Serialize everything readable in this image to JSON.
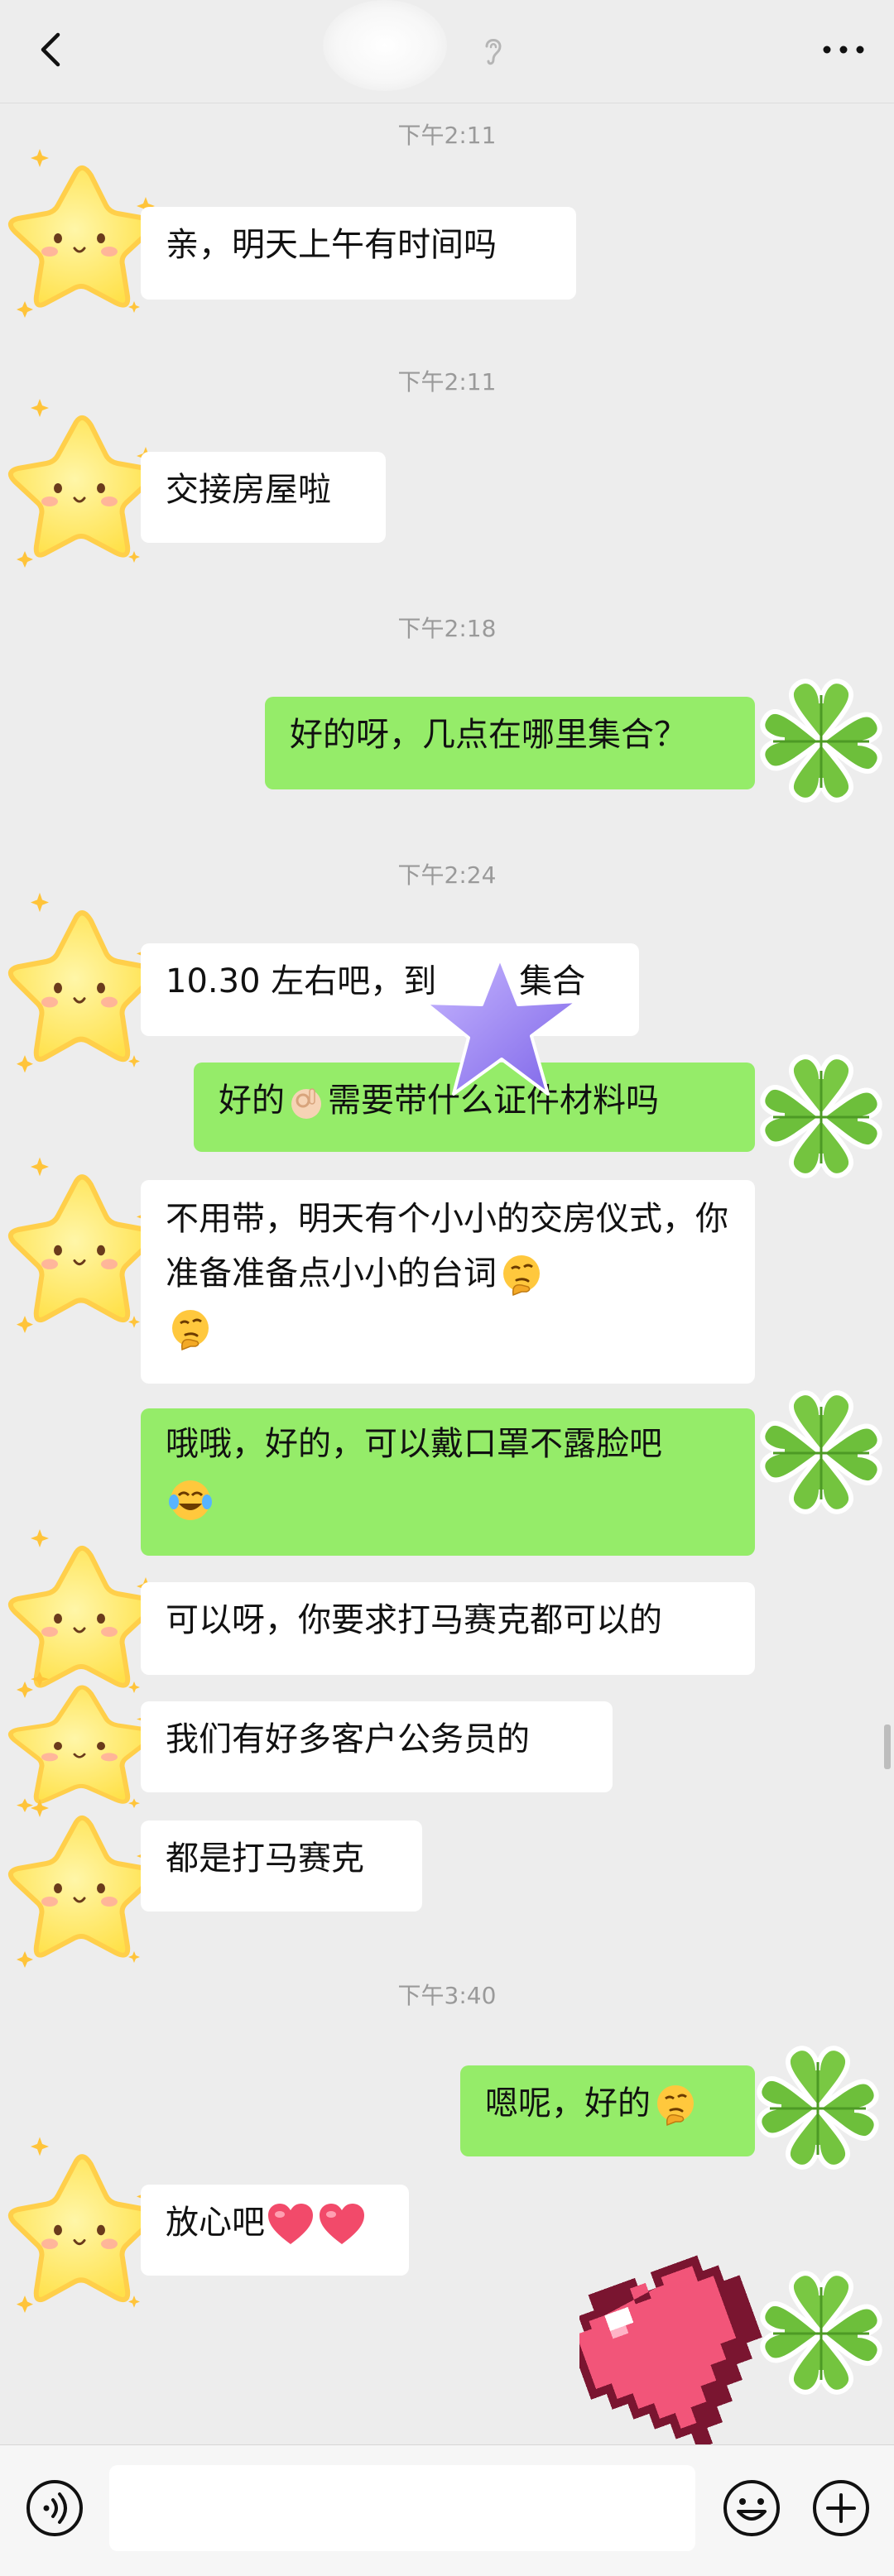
{
  "header": {
    "back_icon": "chevron-left-icon",
    "more_icon": "more-dots-icon",
    "title_hint_icon": "ear-icon"
  },
  "colors": {
    "background": "#ededed",
    "incoming_bubble": "#ffffff",
    "outgoing_bubble": "#95ec69",
    "timestamp": "#9a9a9a"
  },
  "messages": [
    {
      "type": "time",
      "text": "下午2:11"
    },
    {
      "type": "in",
      "text": "亲，明天上午有时间吗"
    },
    {
      "type": "time",
      "text": "下午2:11"
    },
    {
      "type": "in",
      "text": "交接房屋啦"
    },
    {
      "type": "time",
      "text": "下午2:18"
    },
    {
      "type": "out",
      "text": "好的呀，几点在哪里集合？"
    },
    {
      "type": "time",
      "text": "下午2:24"
    },
    {
      "type": "in",
      "text": "10.30 左右吧，到",
      "text_after": "集合",
      "overlay_sticker": "purple-star"
    },
    {
      "type": "out",
      "text_before": "好的",
      "emoji": "ok-hand-emoji",
      "text": "需要带什么证件材料吗"
    },
    {
      "type": "in",
      "text": "不用带，明天有个小小的交房仪式，你准备准备点小小的台词",
      "emoji": "thinking-face-emoji"
    },
    {
      "type": "out",
      "text": "哦哦，好的，可以戴口罩不露脸吧",
      "emoji": "laughing-crying-emoji"
    },
    {
      "type": "in",
      "text": "可以呀，你要求打马赛克都可以的"
    },
    {
      "type": "in",
      "text": "我们有好多客户公务员的"
    },
    {
      "type": "in",
      "text": "都是打马赛克"
    },
    {
      "type": "time",
      "text": "下午3:40"
    },
    {
      "type": "out",
      "text": "嗯呢，好的",
      "emoji": "thinking-face-emoji"
    },
    {
      "type": "in",
      "text": "放心吧",
      "emoji": "two-hearts-emoji"
    },
    {
      "type": "sticker",
      "name": "pixel-heart"
    }
  ],
  "input": {
    "voice_icon": "voice-icon",
    "emoji_icon": "emoji-face-icon",
    "plus_icon": "plus-icon",
    "placeholder": ""
  }
}
